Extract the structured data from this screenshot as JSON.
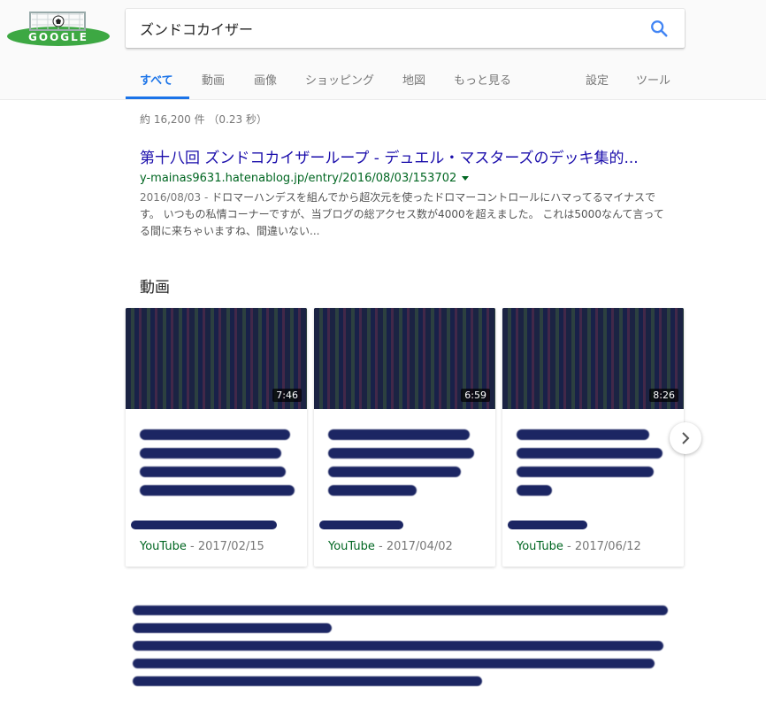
{
  "search": {
    "query": "ズンドコカイザー"
  },
  "tabs": [
    {
      "label": "すべて"
    },
    {
      "label": "動画"
    },
    {
      "label": "画像"
    },
    {
      "label": "ショッピング"
    },
    {
      "label": "地図"
    },
    {
      "label": "もっと見る"
    }
  ],
  "tools": {
    "settings": "設定",
    "tools": "ツール"
  },
  "stats": "約 16,200 件 （0.23 秒）",
  "result1": {
    "title": "第十八回 ズンドコカイザーループ - デュエル・マスターズのデッキ集的...",
    "url": "y-mainas9631.hatenablog.jp/entry/2016/08/03/153702",
    "date": "2016/08/03 - ",
    "snippet": "ドロマーハンデスを組んでから超次元を使ったドロマーコントロールにハマってるマイナスです。 いつもの私情コーナーですが、当ブログの総アクセス数が4000を超えました。 これは5000なんて言ってる間に来ちゃいますね、間違いない..."
  },
  "videos_heading": "動画",
  "videos": [
    {
      "duration": "7:46",
      "source": "YouTube",
      "date": "2017/02/15"
    },
    {
      "duration": "6:59",
      "source": "YouTube",
      "date": "2017/04/02"
    },
    {
      "duration": "8:26",
      "source": "YouTube",
      "date": "2017/06/12"
    }
  ],
  "separator": " - ",
  "colors": {
    "accent": "#1a73e8",
    "link": "#1a0dab",
    "url": "#006621",
    "redaction": "#1c2663"
  },
  "icons": {
    "search": "search-icon",
    "next": "chevron-right-icon",
    "caret": "caret-down-icon"
  }
}
